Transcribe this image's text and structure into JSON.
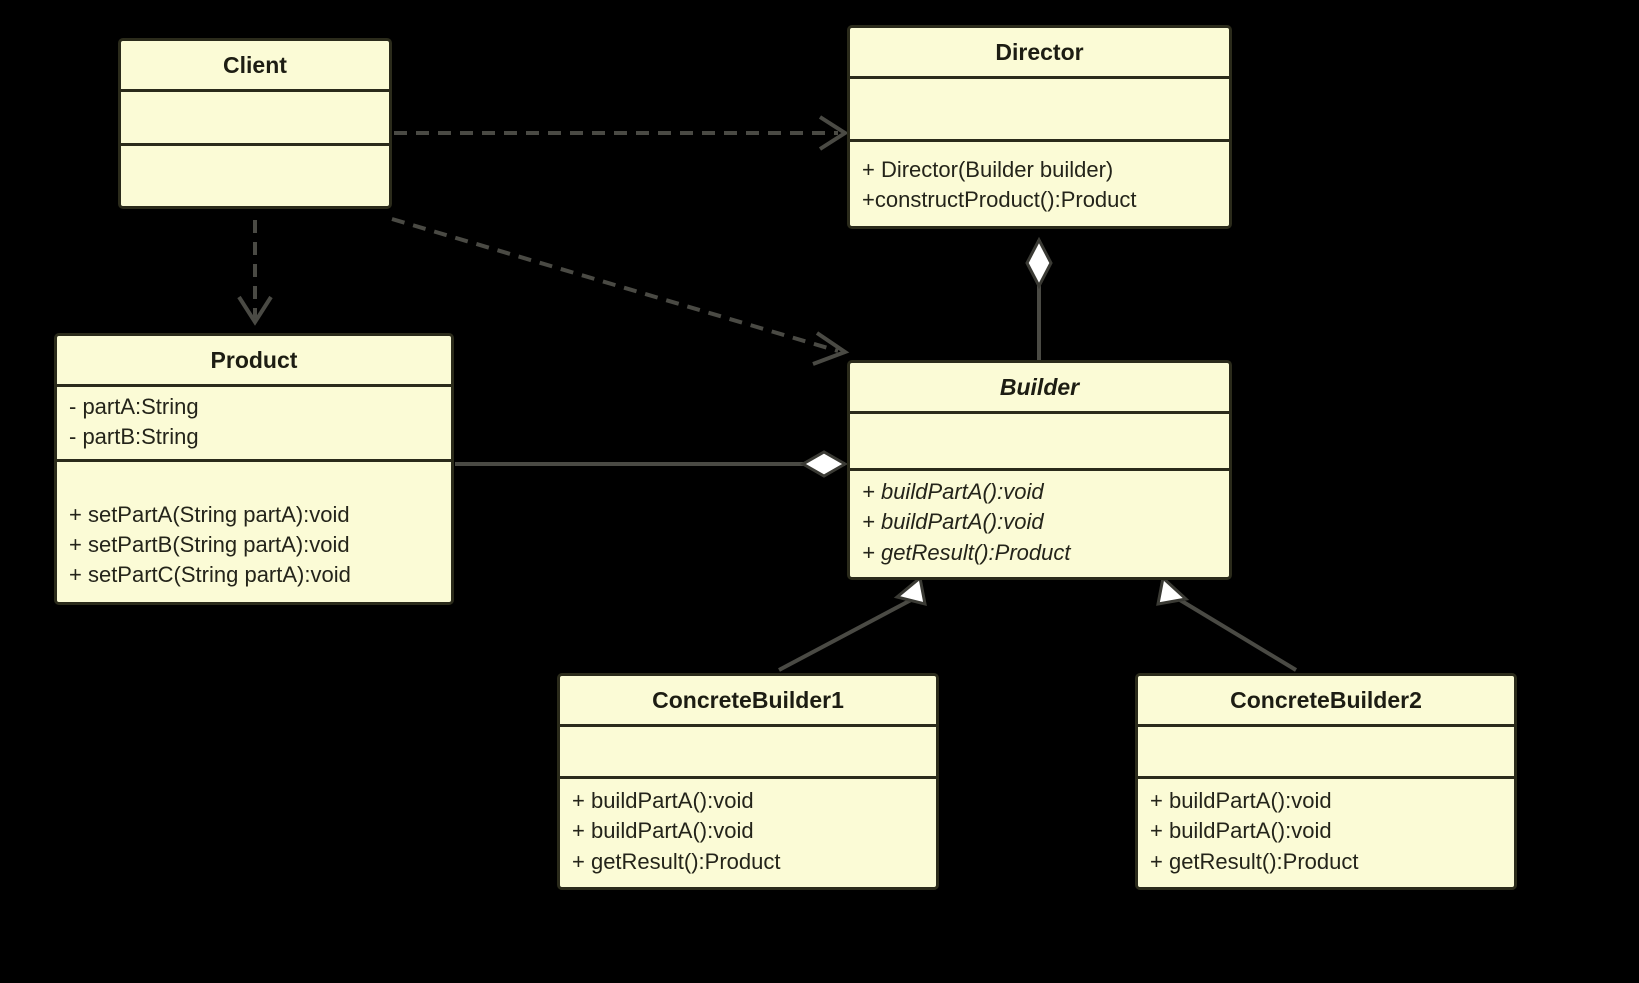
{
  "diagram": {
    "kind": "uml-class-diagram",
    "pattern": "Builder",
    "background_color": "#000000",
    "class_fill_color": "#FBFBD6",
    "class_border_color": "#2B2B1B",
    "text_color": "#24241A",
    "edge_color": "#4A4A44"
  },
  "classes": {
    "client": {
      "name": "Client",
      "abstract": false,
      "attributes": [],
      "methods": []
    },
    "director": {
      "name": "Director",
      "abstract": false,
      "attributes": [],
      "methods": [
        "+ Director(Builder builder)",
        "+constructProduct():Product"
      ]
    },
    "product": {
      "name": "Product",
      "abstract": false,
      "attributes": [
        "- partA:String",
        "- partB:String"
      ],
      "methods": [
        "+ setPartA(String partA):void",
        "+ setPartB(String partA):void",
        "+ setPartC(String partA):void"
      ]
    },
    "builder": {
      "name": "Builder",
      "abstract": true,
      "attributes": [],
      "methods": [
        "+ buildPartA():void",
        "+ buildPartA():void",
        "+ getResult():Product"
      ]
    },
    "concrete_builder_1": {
      "name": "ConcreteBuilder1",
      "abstract": false,
      "attributes": [],
      "methods": [
        "+ buildPartA():void",
        "+ buildPartA():void",
        "+ getResult():Product"
      ]
    },
    "concrete_builder_2": {
      "name": "ConcreteBuilder2",
      "abstract": false,
      "attributes": [],
      "methods": [
        "+ buildPartA():void",
        "+ buildPartA():void",
        "+ getResult():Product"
      ]
    }
  },
  "relationships": [
    {
      "id": "client-director",
      "from": "Client",
      "to": "Director",
      "type": "dependency",
      "line": "dashed",
      "arrow": "open-arrow"
    },
    {
      "id": "client-product",
      "from": "Client",
      "to": "Product",
      "type": "dependency",
      "line": "dashed",
      "arrow": "open-arrow"
    },
    {
      "id": "client-builder",
      "from": "Client",
      "to": "Builder",
      "type": "dependency",
      "line": "dashed",
      "arrow": "open-arrow"
    },
    {
      "id": "director-builder",
      "from": "Director",
      "to": "Builder",
      "type": "aggregation",
      "line": "solid",
      "arrow": "hollow-diamond"
    },
    {
      "id": "product-builder",
      "from": "Product",
      "to": "Builder",
      "type": "aggregation",
      "line": "solid",
      "arrow": "hollow-diamond"
    },
    {
      "id": "cb1-builder",
      "from": "ConcreteBuilder1",
      "to": "Builder",
      "type": "generalization",
      "line": "solid",
      "arrow": "hollow-triangle"
    },
    {
      "id": "cb2-builder",
      "from": "ConcreteBuilder2",
      "to": "Builder",
      "type": "generalization",
      "line": "solid",
      "arrow": "hollow-triangle"
    }
  ]
}
